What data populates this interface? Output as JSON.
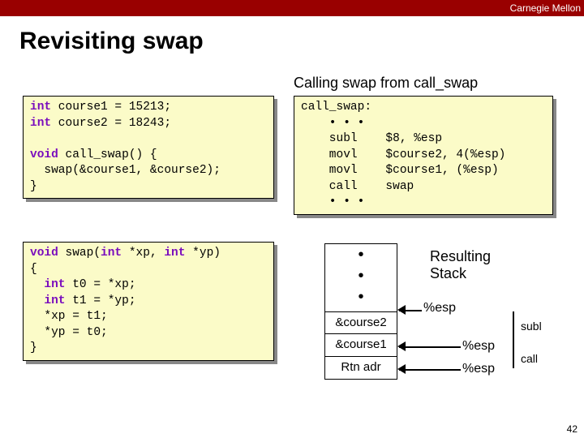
{
  "header": {
    "org": "Carnegie Mellon"
  },
  "title": "Revisiting swap",
  "subtitle": "Calling swap from call_swap",
  "code": {
    "c1": "int course1 = 15213;\nint course2 = 18243;\n\nvoid call_swap() {\n  swap(&course1, &course2);\n}",
    "c2": "void swap(int *xp, int *yp)\n{\n  int t0 = *xp;\n  int t1 = *yp;\n  *xp = t1;\n  *yp = t0;\n}",
    "asm": "call_swap:\n    • • •\n    subl    $8, %esp\n    movl    $course2, 4(%esp)\n    movl    $course1, (%esp)\n    call    swap\n    • • •"
  },
  "stack": {
    "title": "Resulting\nStack",
    "cells": [
      "&course2",
      "&course1",
      "Rtn adr"
    ],
    "esp": "%esp",
    "labels": {
      "subl": "subl",
      "call": "call"
    }
  },
  "pagenum": "42"
}
